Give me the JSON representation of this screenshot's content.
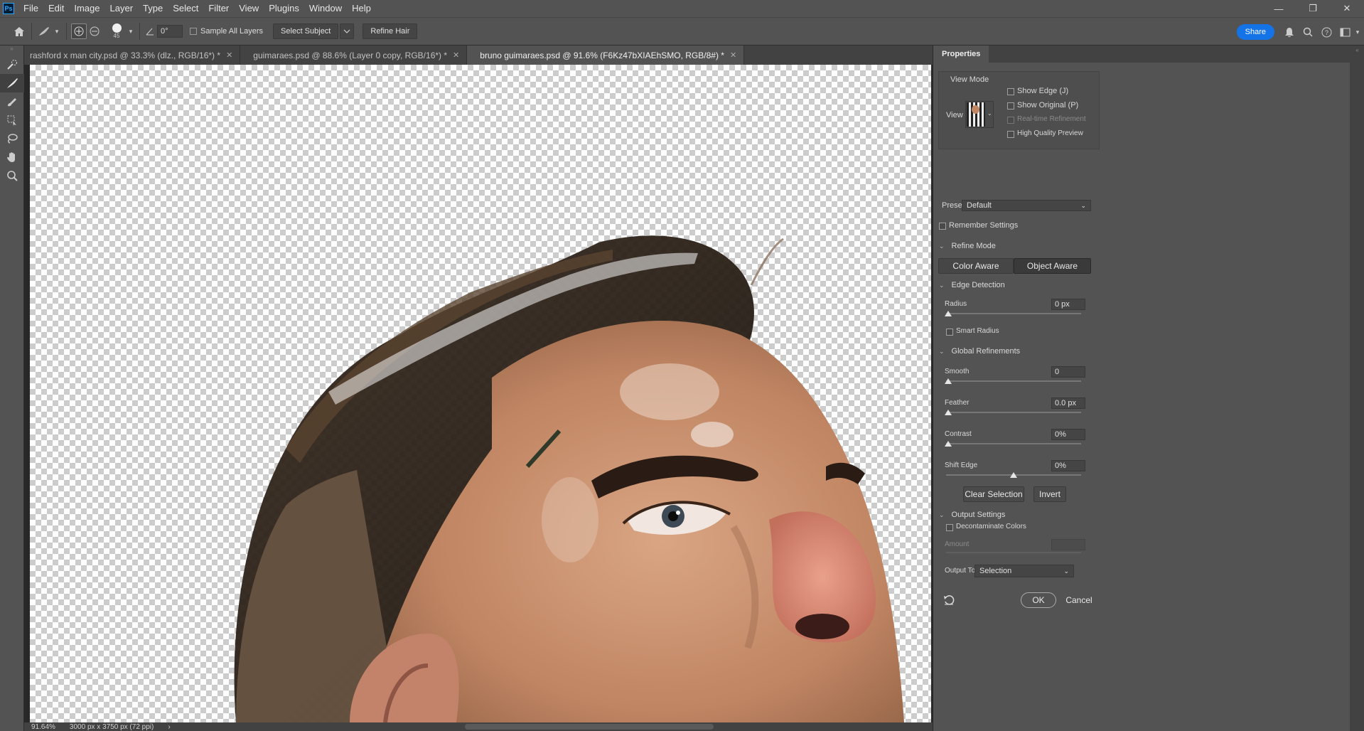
{
  "menu": [
    "File",
    "Edit",
    "Image",
    "Layer",
    "Type",
    "Select",
    "Filter",
    "View",
    "Plugins",
    "Window",
    "Help"
  ],
  "logo": "Ps",
  "options": {
    "brush_size": "45",
    "angle": "0°",
    "sample_all_layers": "Sample All Layers",
    "select_subject": "Select Subject",
    "refine_hair": "Refine Hair",
    "share": "Share"
  },
  "tabs": [
    {
      "label": "rashford x man city.psd @ 33.3% (dlz., RGB/16*) *"
    },
    {
      "label": "guimaraes.psd @ 88.6% (Layer 0 copy, RGB/16*) *"
    },
    {
      "label": "bruno guimaraes.psd @ 91.6% (F6Kz47bXIAEhSMO, RGB/8#) *"
    }
  ],
  "status": {
    "zoom": "91.64%",
    "doc": "3000 px x 3750 px (72 ppi)"
  },
  "panel": {
    "title": "Properties",
    "view_mode": "View Mode",
    "view": "View",
    "show_edge": "Show Edge (J)",
    "show_original": "Show Original (P)",
    "realtime": "Real-time Refinement",
    "hq_preview": "High Quality Preview",
    "preset_label": "Preset",
    "preset_value": "Default",
    "remember": "Remember Settings",
    "refine_mode": "Refine Mode",
    "color_aware": "Color Aware",
    "object_aware": "Object Aware",
    "edge_detection": "Edge Detection",
    "radius": "Radius",
    "radius_value": "0 px",
    "smart_radius": "Smart Radius",
    "global_refinements": "Global Refinements",
    "smooth": "Smooth",
    "smooth_value": "0",
    "feather": "Feather",
    "feather_value": "0.0 px",
    "contrast": "Contrast",
    "contrast_value": "0%",
    "shift_edge": "Shift Edge",
    "shift_edge_value": "0%",
    "clear_selection": "Clear Selection",
    "invert": "Invert",
    "output_settings": "Output Settings",
    "decontaminate": "Decontaminate Colors",
    "amount": "Amount",
    "output_to": "Output To",
    "output_to_value": "Selection",
    "ok": "OK",
    "cancel": "Cancel"
  },
  "colors": {
    "share": "#1473e6",
    "ui_bg": "#535353",
    "panel_dark": "#3b3b3b"
  }
}
